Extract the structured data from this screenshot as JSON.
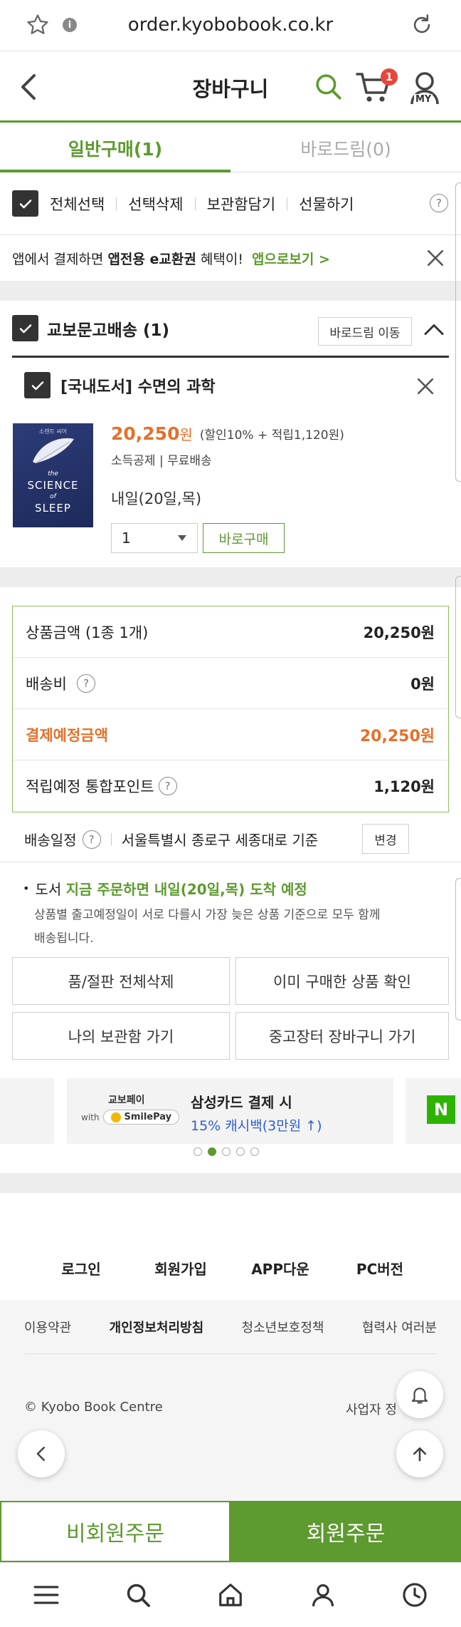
{
  "browser": {
    "url": "order.kyobobook.co.kr"
  },
  "header": {
    "title": "장바구니",
    "cart_count": "1",
    "my_label": "MY"
  },
  "tabs": [
    {
      "label": "일반구매(1)"
    },
    {
      "label": "바로드림(0)"
    }
  ],
  "actions": {
    "select_all": "전체선택",
    "delete_selected": "선택삭제",
    "save_box": "보관함담기",
    "gift": "선물하기"
  },
  "app_banner": {
    "text_prefix": "앱에서 결제하면 ",
    "text_bold": "앱전용 e교환권",
    "text_suffix": " 혜택이!",
    "link": "앱으로보기 >"
  },
  "shipping_group": {
    "title": "교보문고배송 (1)",
    "move_button": "바로드림 이동"
  },
  "item": {
    "title": "[국내도서] 수면의 과학",
    "price": "20,250",
    "price_unit": "원",
    "discount": "(할인10% + 적립1,120원)",
    "tags": "소득공제 | 무료배송",
    "delivery": "내일(20일,목)",
    "quantity": "1",
    "buy_now": "바로구매",
    "cover": {
      "line1": "the",
      "line2": "SCIENCE",
      "line3": "of",
      "line4": "SLEEP",
      "top": "소렌트 씨어"
    }
  },
  "summary": {
    "product_amount_label": "상품금액 (1종 1개)",
    "product_amount": "20,250원",
    "shipping_label": "배송비",
    "shipping": "0원",
    "payment_label": "결제예정금액",
    "payment": "20,250원",
    "points_label": "적립예정 통합포인트",
    "points": "1,120원"
  },
  "delivery_schedule": {
    "label": "배송일정",
    "region": "서울특별시 종로구 세종대로 기준",
    "change": "변경"
  },
  "notice": {
    "prefix": "도서 ",
    "highlight": "지금 주문하면 내일(20일,목) 도착 예정",
    "line2": "상품별 출고예정일이 서로 다를시 가장 늦은 상품 기준으로 모두 함께",
    "line3": "배송됩니다."
  },
  "buttons": {
    "delete_soldout": "품/절판 전체삭제",
    "check_purchased": "이미 구매한 상품 확인",
    "go_box": "나의 보관함 가기",
    "used_cart": "중고장터 장바구니 가기"
  },
  "promo": {
    "brand": "교보페이",
    "with": "with",
    "smilepay": "SmilePay",
    "title": "삼성카드 결제 시",
    "desc": "15% 캐시백(3만원 ↑)",
    "next_badge": "N"
  },
  "footer": {
    "links1": [
      "로그인",
      "회원가입",
      "APP다운",
      "PC버전"
    ],
    "links2": [
      "이용약관",
      "개인정보처리방침",
      "청소년보호정책",
      "협력사 여러분"
    ],
    "copyright": "© Kyobo Book Centre",
    "business": "사업자 정"
  },
  "order_bar": {
    "guest": "비회원주문",
    "member": "회원주문"
  },
  "colors": {
    "accent": "#5d9a2f",
    "price": "#e5702a",
    "badge": "#e8453c"
  }
}
